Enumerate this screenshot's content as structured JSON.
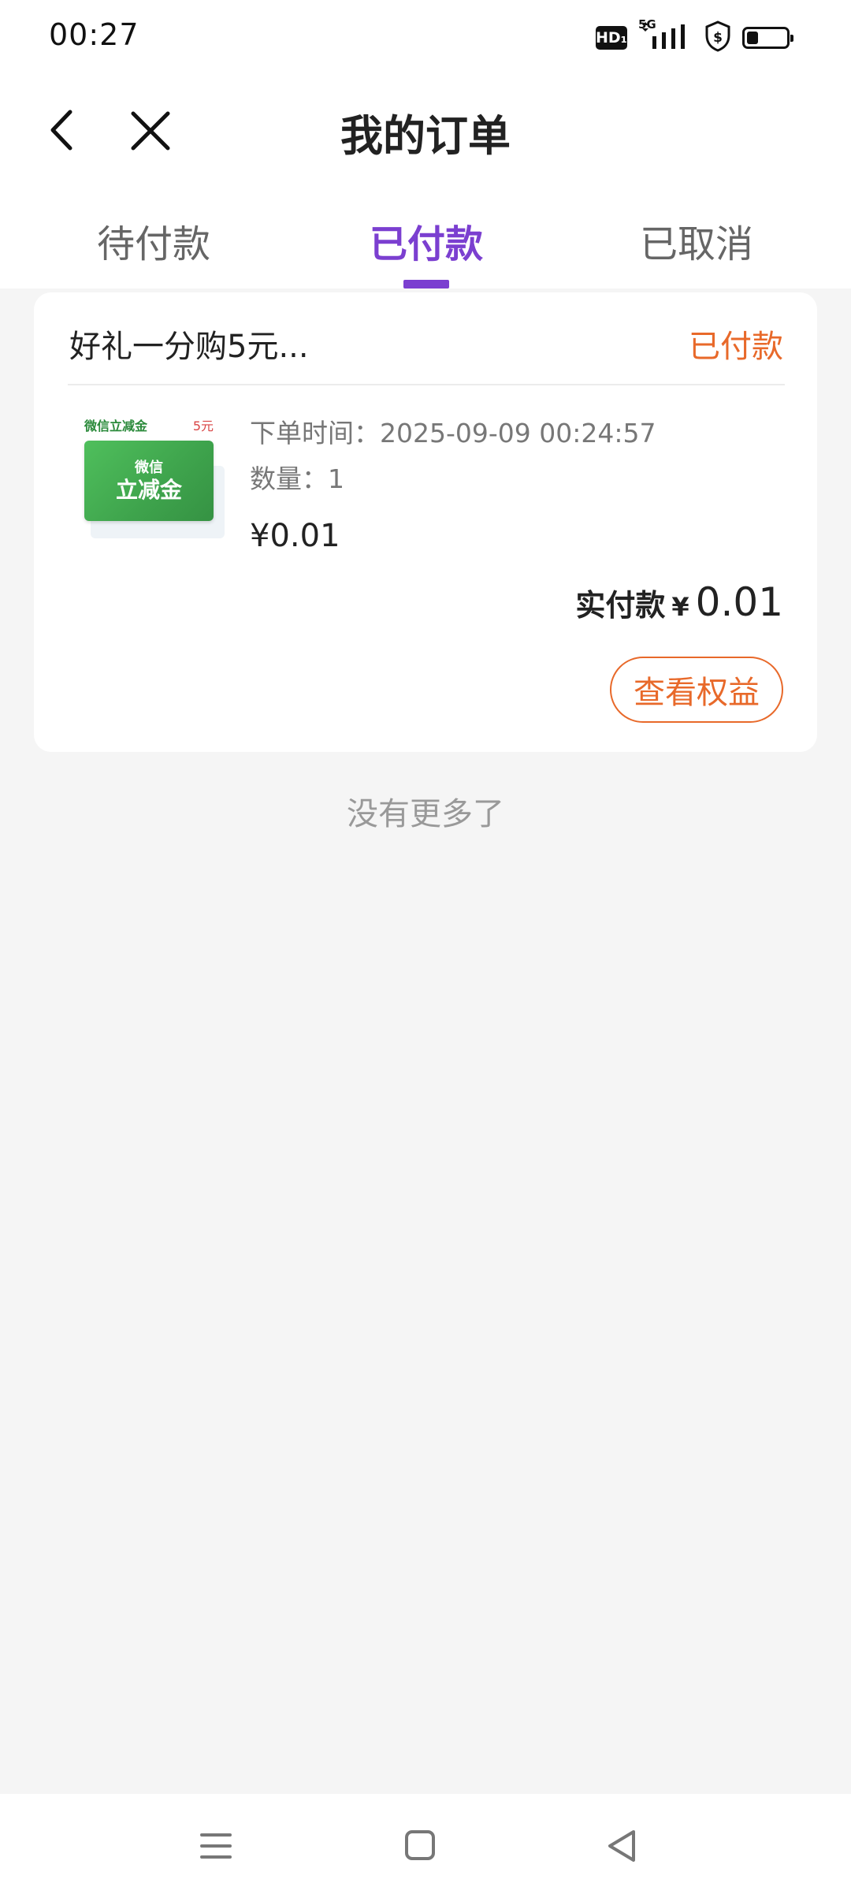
{
  "status_bar": {
    "time": "00:27",
    "hd_label": "HD₁",
    "network_label": "5G",
    "battery_level": 0.3
  },
  "header": {
    "title": "我的订单",
    "back_icon": "chevron-left-icon",
    "close_icon": "close-icon"
  },
  "tabs": [
    {
      "label": "待付款",
      "active": false
    },
    {
      "label": "已付款",
      "active": true
    },
    {
      "label": "已取消",
      "active": false
    }
  ],
  "order": {
    "name": "好礼一分购5元...",
    "status": "已付款",
    "image": {
      "top_label": "微信立减金",
      "top_price": "5元",
      "card_line1": "微信",
      "card_line2": "立减金"
    },
    "order_time": "下单时间：2025-09-09 00:24:57",
    "quantity": "数量：1",
    "price": "¥0.01",
    "paid_label": "实付款",
    "paid_currency": "¥",
    "paid_amount": "0.01",
    "action_label": "查看权益"
  },
  "footer_text": "没有更多了",
  "colors": {
    "accent": "#7b3fd0",
    "status": "#e8692a",
    "background": "#f5f5f5"
  },
  "bottom_nav": [
    "menu-icon",
    "home-square-icon",
    "back-triangle-icon"
  ]
}
